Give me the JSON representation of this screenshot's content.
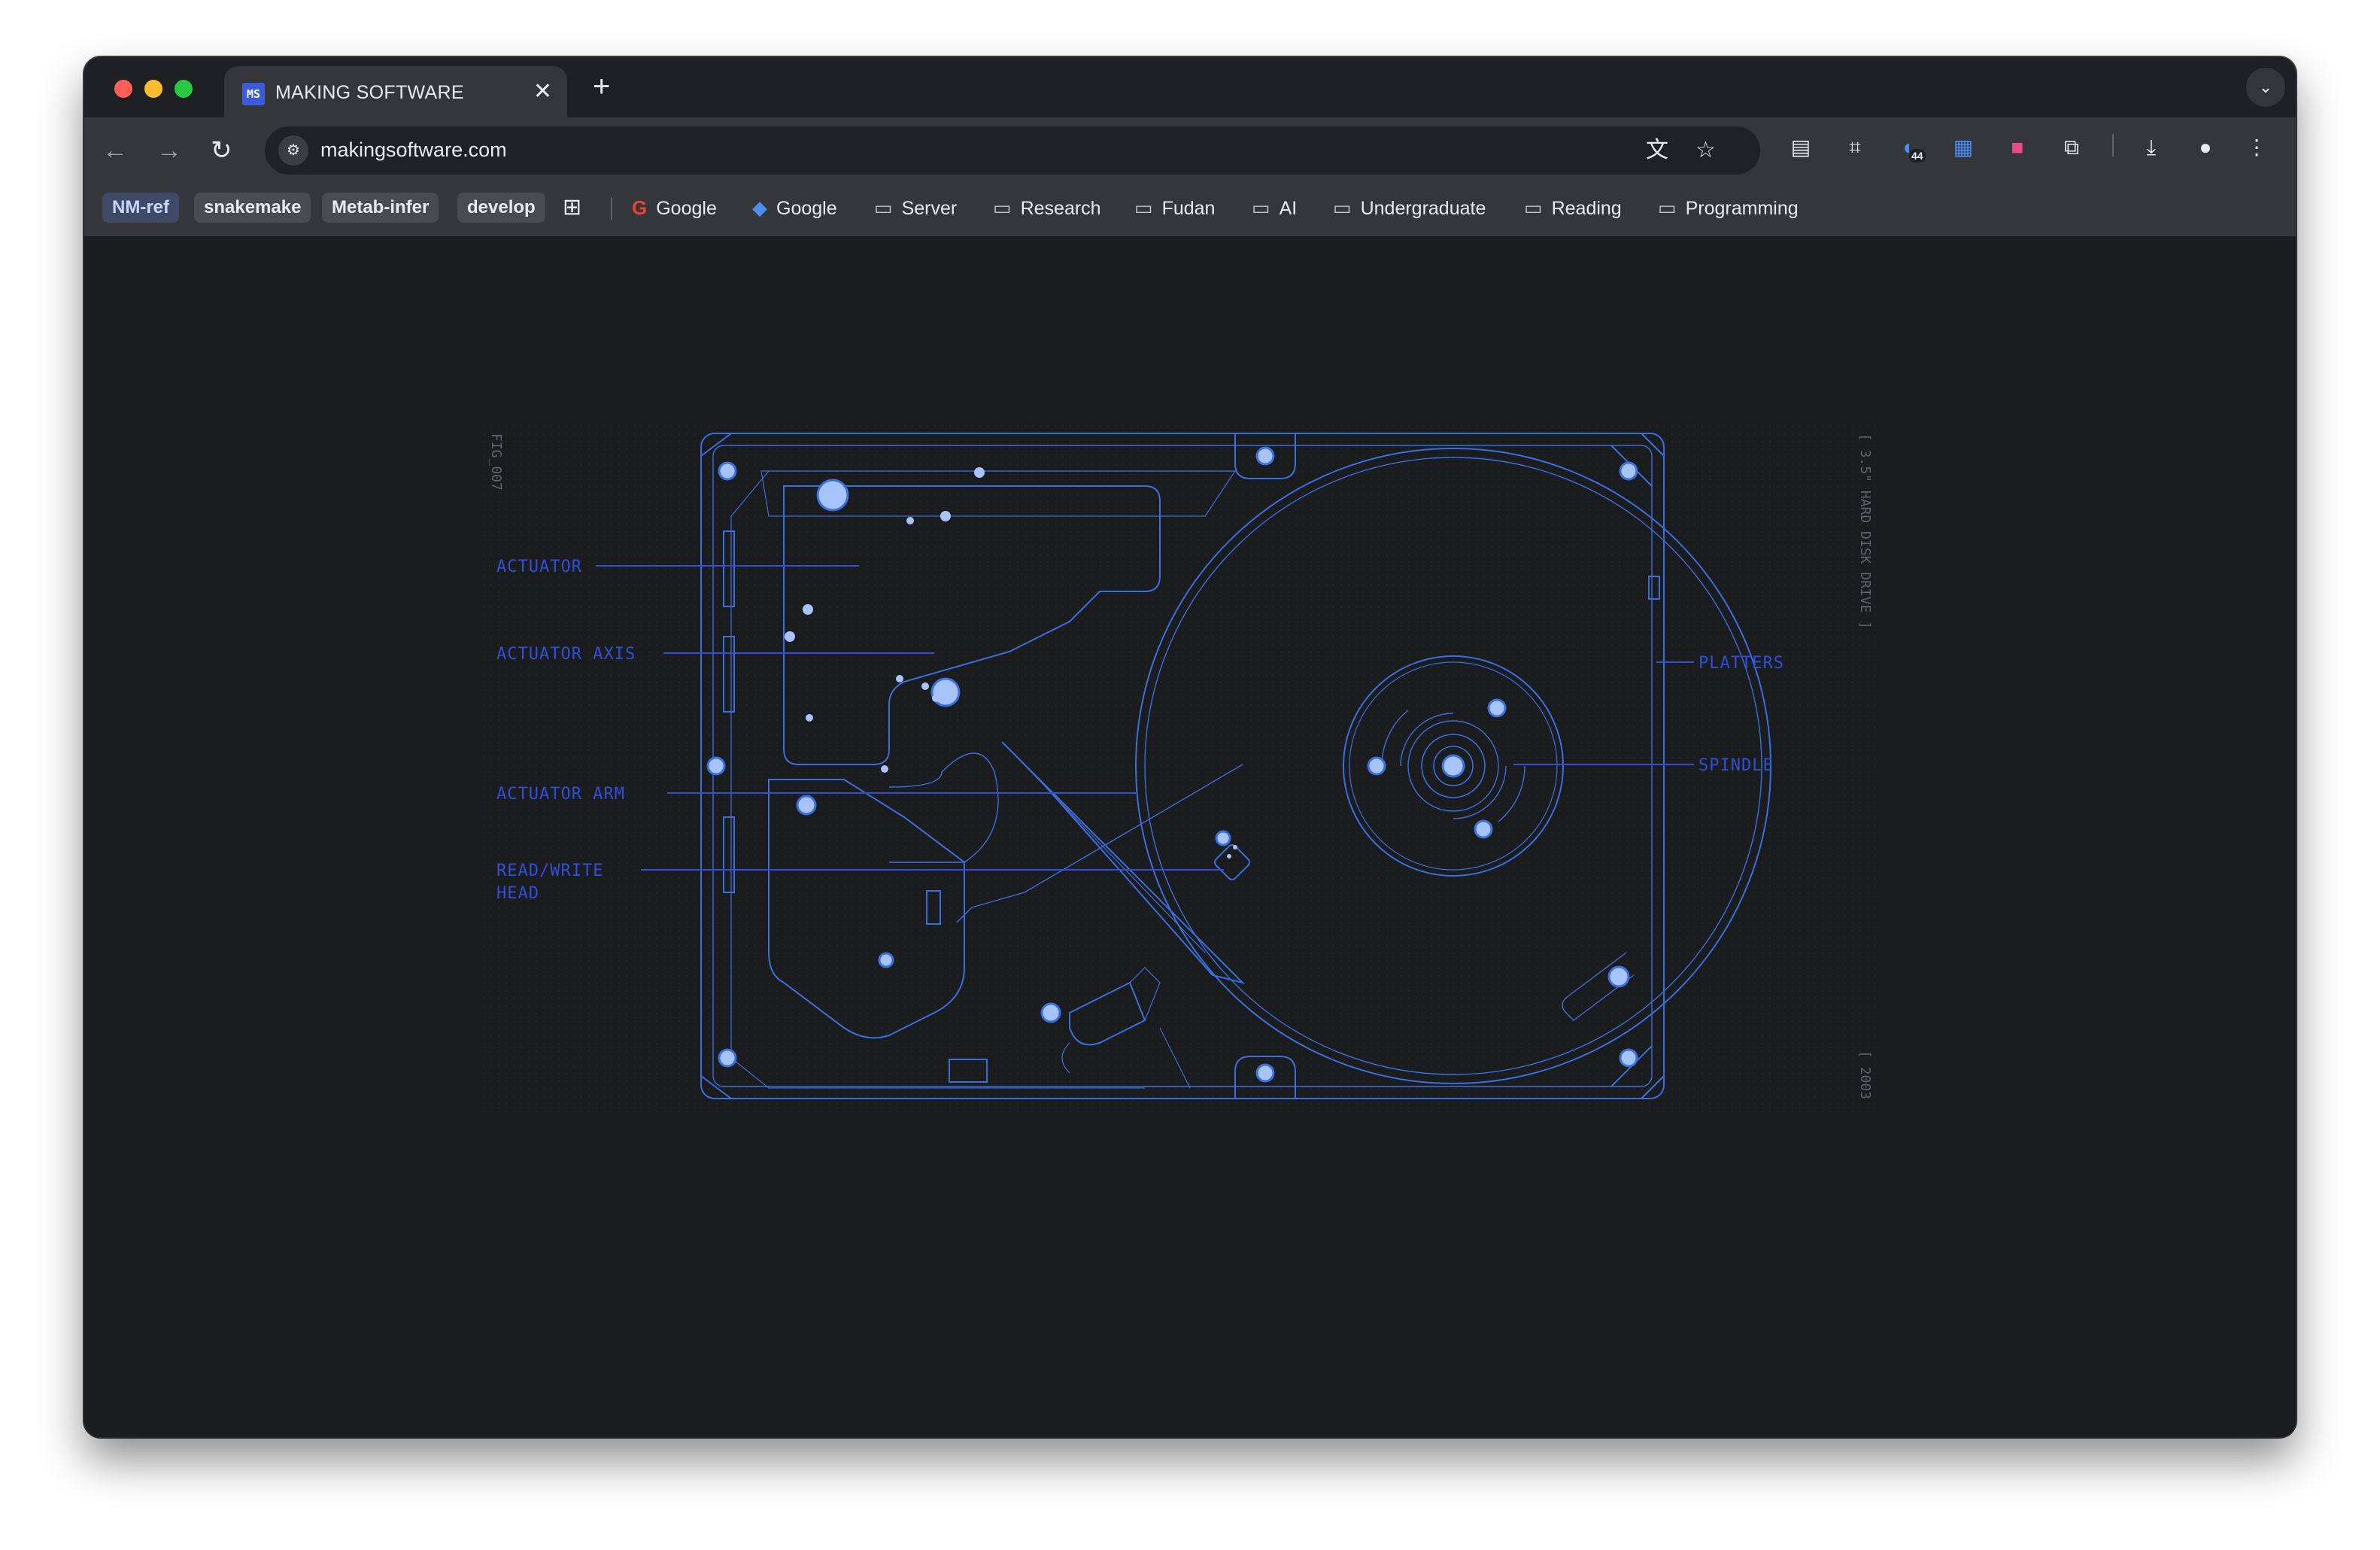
{
  "tab": {
    "favicon_text": "MS",
    "title": "MAKING SOFTWARE",
    "close_glyph": "✕",
    "new_tab_glyph": "+"
  },
  "address_bar": {
    "url": "makingsoftware.com"
  },
  "extensions": {
    "badge_count": "44"
  },
  "bookmarks": {
    "chips": [
      "NM-ref",
      "snakemake",
      "Metab-infer",
      "develop"
    ],
    "links": [
      {
        "label": "Google",
        "icon": "google-icon"
      },
      {
        "label": "Google",
        "icon": "gemini-icon"
      },
      {
        "label": "Server",
        "icon": "folder-icon"
      },
      {
        "label": "Research",
        "icon": "folder-icon"
      },
      {
        "label": "Fudan",
        "icon": "folder-icon"
      },
      {
        "label": "AI",
        "icon": "folder-icon"
      },
      {
        "label": "Undergraduate",
        "icon": "folder-icon"
      },
      {
        "label": "Reading",
        "icon": "folder-icon"
      },
      {
        "label": "Programming",
        "icon": "folder-icon"
      }
    ]
  },
  "figure": {
    "fig_id": "FIG_007",
    "side_title": "[ 3.5\" HARD DISK DRIVE ]",
    "year": "[ 2003",
    "labels": {
      "actuator": "ACTUATOR",
      "actuator_axis": "ACTUATOR AXIS",
      "actuator_arm": "ACTUATOR ARM",
      "rw_head_line1": "READ/WRITE",
      "rw_head_line2": "HEAD",
      "platters": "PLATTERS",
      "spindle": "SPINDLE"
    },
    "colors": {
      "line": "#3a6fe0",
      "label": "#2f4fd8",
      "screw": "#a7c4ff",
      "muted_text": "#5f6368"
    }
  }
}
